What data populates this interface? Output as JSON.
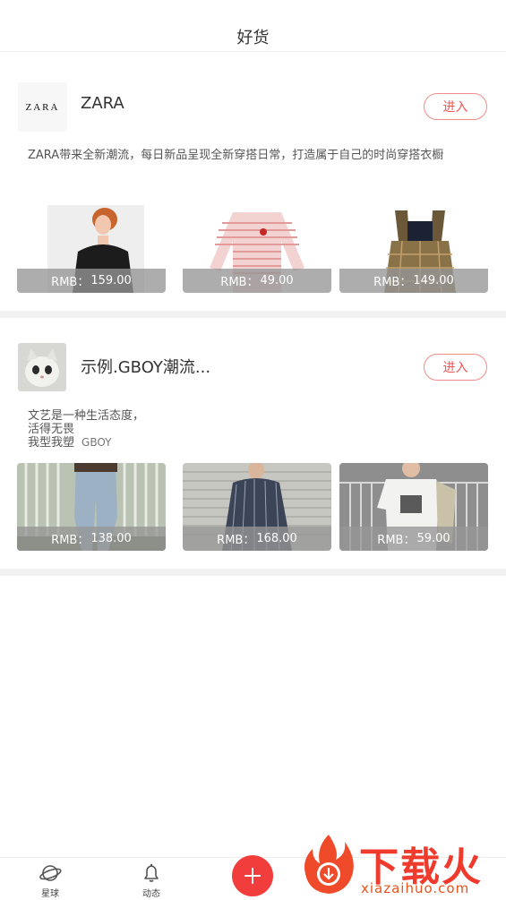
{
  "header": {
    "title": "好货"
  },
  "shops": [
    {
      "name": "ZARA",
      "logo_text": "ZARA",
      "enter_label": "进入",
      "description": "ZARA带来全新潮流，每日新品呈现全新穿搭日常，打造属于自己的时尚穿搭衣橱",
      "products": [
        {
          "price_prefix": "RMB：",
          "price": "159.00"
        },
        {
          "price_prefix": "RMB：",
          "price": "49.00"
        },
        {
          "price_prefix": "RMB：",
          "price": "149.00"
        }
      ]
    },
    {
      "name": "示例.GBOY潮流...",
      "enter_label": "进入",
      "description_lines": [
        "文艺是一种生活态度，",
        "活得无畏",
        "我型我塑"
      ],
      "tag": "GBOY",
      "products": [
        {
          "price_prefix": "RMB：",
          "price": "138.00"
        },
        {
          "price_prefix": "RMB：",
          "price": "168.00"
        },
        {
          "price_prefix": "RMB：",
          "price": "59.00"
        }
      ]
    }
  ],
  "tabbar": {
    "tabs": [
      {
        "label": "星球",
        "icon": "planet-icon"
      },
      {
        "label": "动态",
        "icon": "bell-icon"
      }
    ],
    "fab_icon": "plus-icon"
  },
  "watermark": {
    "title": "下载火",
    "url": "xiazaihuo.com"
  },
  "colors": {
    "accent": "#f23d3d",
    "enter_border": "#f08b8b",
    "divider": "#f2f2f2"
  }
}
